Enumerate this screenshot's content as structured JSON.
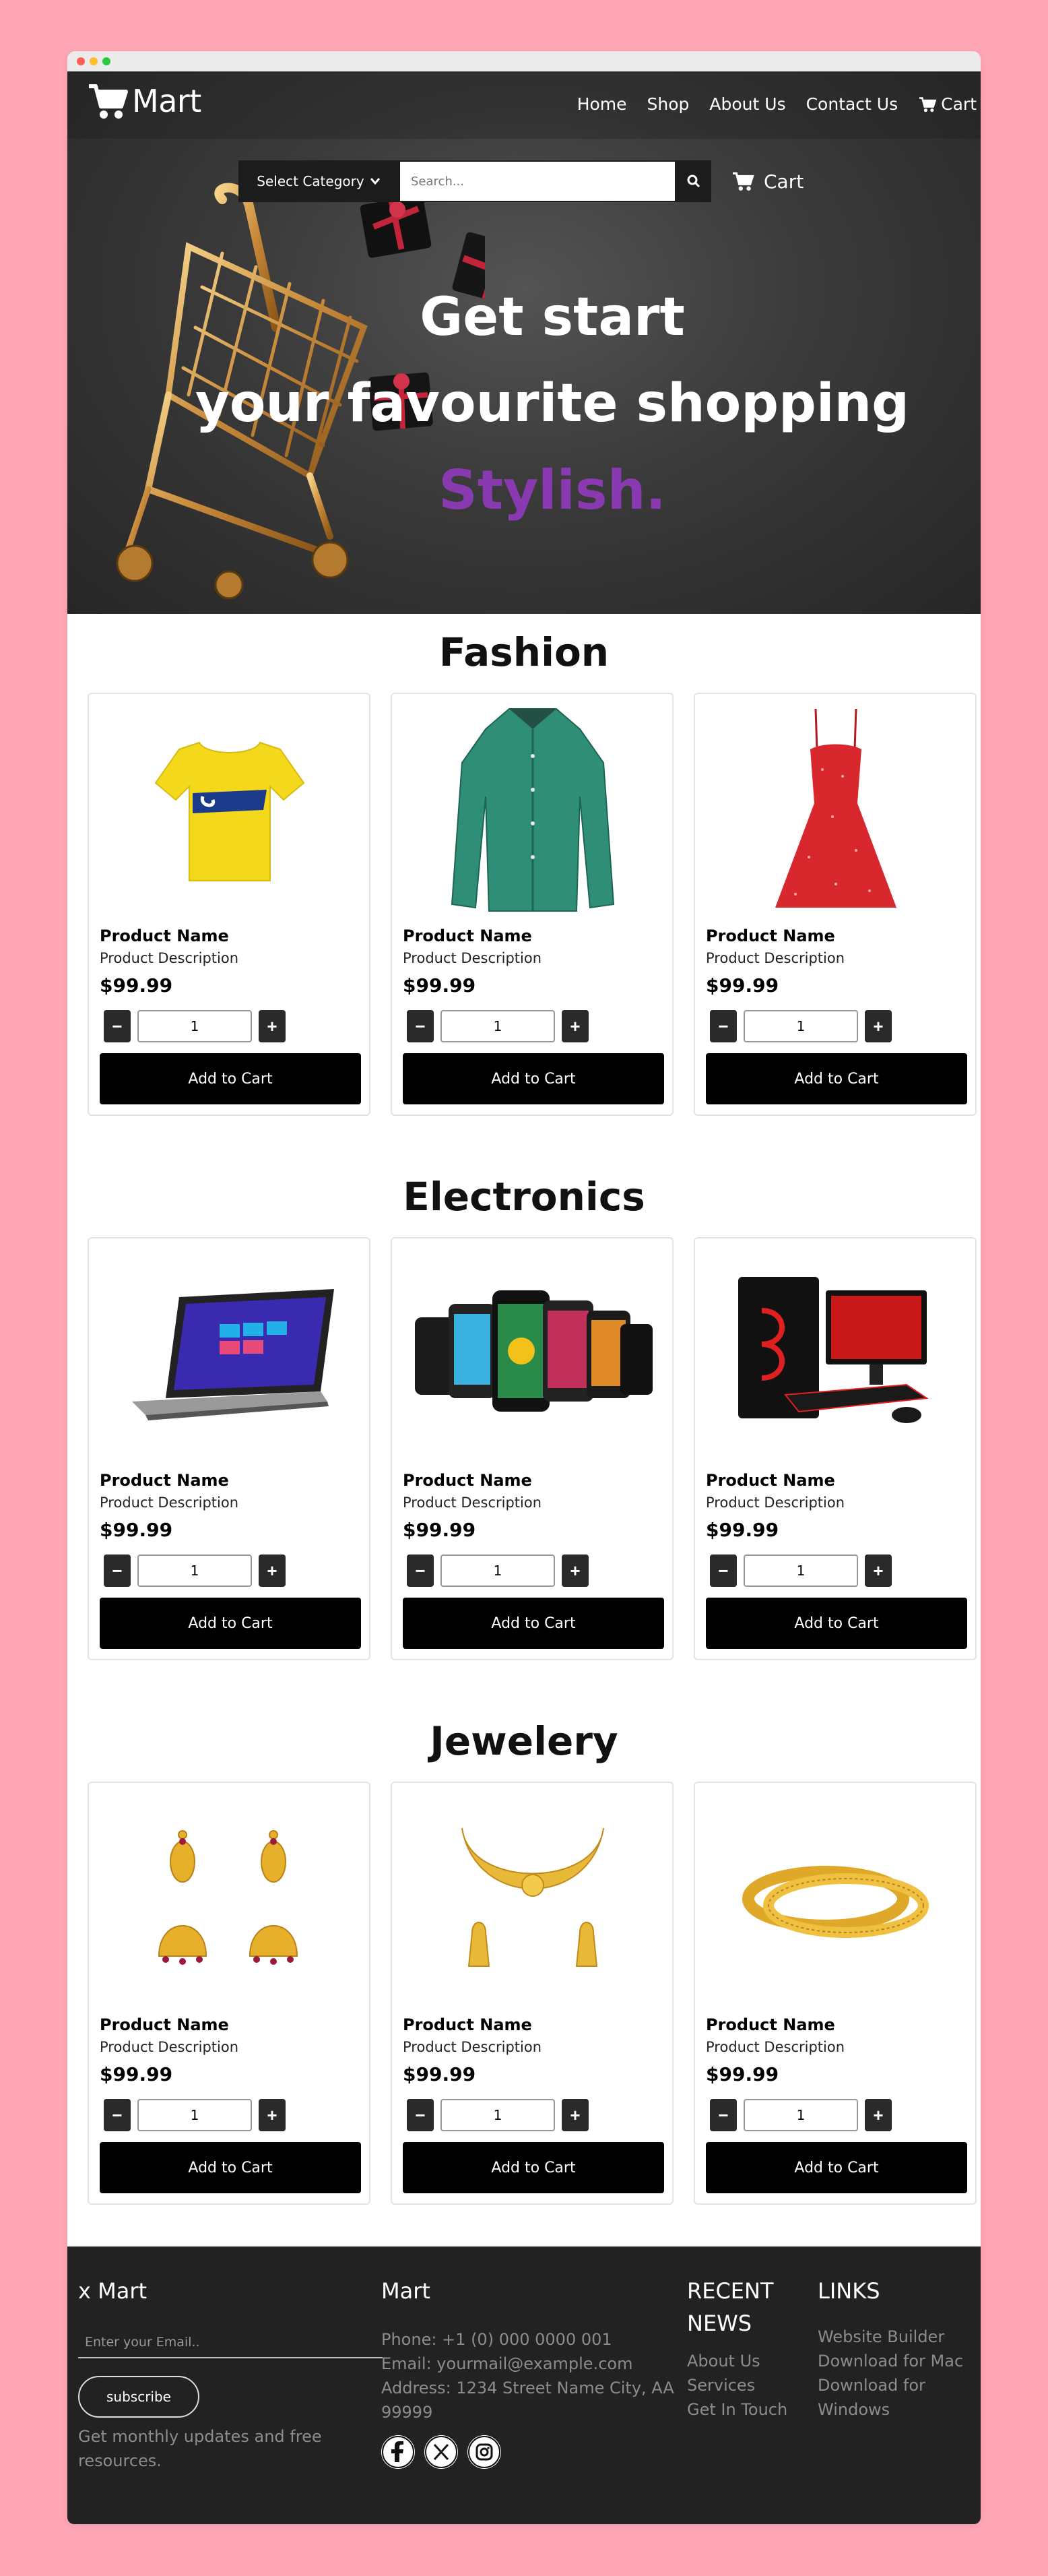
{
  "brand": {
    "name": "Mart"
  },
  "nav": [
    {
      "label": "Home"
    },
    {
      "label": "Shop"
    },
    {
      "label": "About Us"
    },
    {
      "label": "Contact Us"
    },
    {
      "label": "Cart",
      "icon": "cart-icon"
    }
  ],
  "search": {
    "category_label": "Select Category",
    "placeholder": "Search...",
    "cart_label": "Cart"
  },
  "hero": {
    "line1": "Get start",
    "line2": "your favourite shopping",
    "line3": "Stylish.",
    "accent_color": "#8a3ab0"
  },
  "sections": [
    {
      "title": "Fashion",
      "products": [
        {
          "name": "Product Name",
          "description": "Product Description",
          "price": "$99.99",
          "qty": "1",
          "add_label": "Add to Cart",
          "image": "yellow-tshirt"
        },
        {
          "name": "Product Name",
          "description": "Product Description",
          "price": "$99.99",
          "qty": "1",
          "add_label": "Add to Cart",
          "image": "green-shirt"
        },
        {
          "name": "Product Name",
          "description": "Product Description",
          "price": "$99.99",
          "qty": "1",
          "add_label": "Add to Cart",
          "image": "red-dress"
        }
      ]
    },
    {
      "title": "Electronics",
      "products": [
        {
          "name": "Product Name",
          "description": "Product Description",
          "price": "$99.99",
          "qty": "1",
          "add_label": "Add to Cart",
          "image": "laptop"
        },
        {
          "name": "Product Name",
          "description": "Product Description",
          "price": "$99.99",
          "qty": "1",
          "add_label": "Add to Cart",
          "image": "smartphones"
        },
        {
          "name": "Product Name",
          "description": "Product Description",
          "price": "$99.99",
          "qty": "1",
          "add_label": "Add to Cart",
          "image": "gaming-pc"
        }
      ]
    },
    {
      "title": "Jewelery",
      "products": [
        {
          "name": "Product Name",
          "description": "Product Description",
          "price": "$99.99",
          "qty": "1",
          "add_label": "Add to Cart",
          "image": "earrings"
        },
        {
          "name": "Product Name",
          "description": "Product Description",
          "price": "$99.99",
          "qty": "1",
          "add_label": "Add to Cart",
          "image": "necklace-set"
        },
        {
          "name": "Product Name",
          "description": "Product Description",
          "price": "$99.99",
          "qty": "1",
          "add_label": "Add to Cart",
          "image": "bangles"
        }
      ]
    }
  ],
  "footer": {
    "col1": {
      "title": "x Mart",
      "email_placeholder": "Enter your Email..",
      "subscribe_label": "subscribe",
      "note": "Get monthly updates and free resources."
    },
    "col2": {
      "title": "Mart",
      "phone": "Phone: +1 (0) 000 0000 001",
      "email": "Email: yourmail@example.com",
      "address": "Address: 1234 Street Name City, AA 99999"
    },
    "col3": {
      "title": "RECENT NEWS",
      "links": [
        "About Us",
        "Services",
        "Get In Touch"
      ]
    },
    "col4": {
      "title": "LINKS",
      "links": [
        "Website Builder",
        "Download for Mac",
        "Download for Windows"
      ]
    },
    "social": [
      "facebook-icon",
      "x-icon",
      "instagram-icon"
    ]
  }
}
